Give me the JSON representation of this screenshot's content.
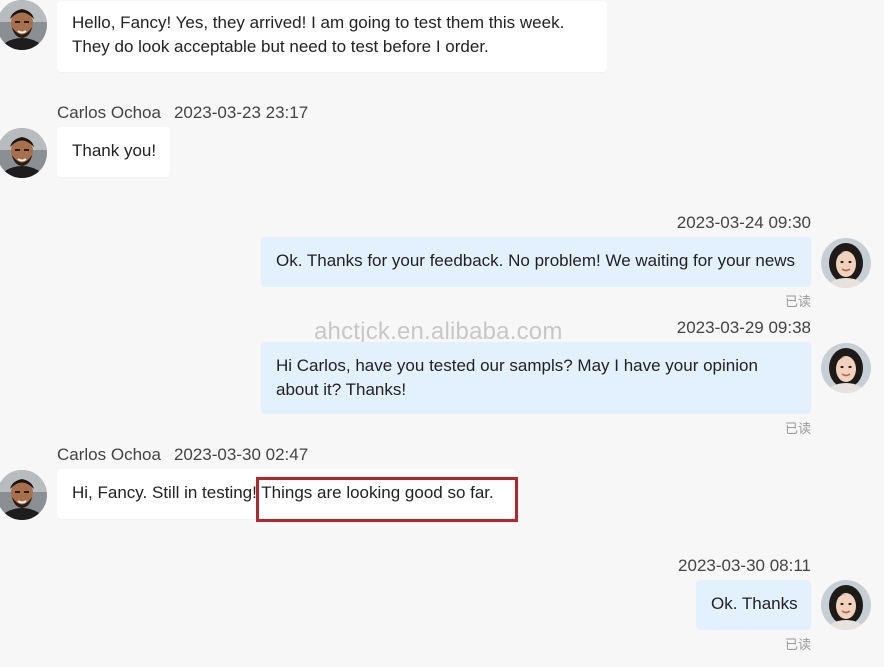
{
  "messages": [
    {
      "sender": "",
      "time": "",
      "direction": "in",
      "lines": [
        "Hello, Fancy! Yes, they arrived! I am going to test them this week.",
        "They do look acceptable but need to test before I order."
      ],
      "avatar": "male-avatar"
    },
    {
      "sender": "Carlos Ochoa",
      "time": "2023-03-23 23:17",
      "direction": "in",
      "lines": [
        "Thank you!"
      ],
      "avatar": "male-avatar"
    },
    {
      "sender": "",
      "time": "2023-03-24 09:30",
      "direction": "out",
      "lines": [
        "Ok. Thanks for your feedback. No problem! We waiting for your news"
      ],
      "read_status": "已读",
      "avatar": "female-avatar"
    },
    {
      "sender": "",
      "time": "2023-03-29 09:38",
      "direction": "out",
      "lines": [
        "Hi Carlos, have you tested our sampls? May I have your opinion",
        "about it? Thanks!"
      ],
      "read_status": "已读",
      "avatar": "female-avatar"
    },
    {
      "sender": "Carlos Ochoa",
      "time": "2023-03-30 02:47",
      "direction": "in",
      "lines": [
        "Hi, Fancy. Still in testing! Things are looking good so far."
      ],
      "avatar": "male-avatar"
    },
    {
      "sender": "",
      "time": "2023-03-30 08:11",
      "direction": "out",
      "lines": [
        "Ok. Thanks"
      ],
      "read_status": "已读",
      "avatar": "female-avatar"
    }
  ],
  "watermark": "ahctjck.en.alibaba.com",
  "colors": {
    "background": "#f7f7f7",
    "incoming_bubble": "#ffffff",
    "outgoing_bubble": "#e3f0fd",
    "highlight_box": "#b3262b"
  }
}
